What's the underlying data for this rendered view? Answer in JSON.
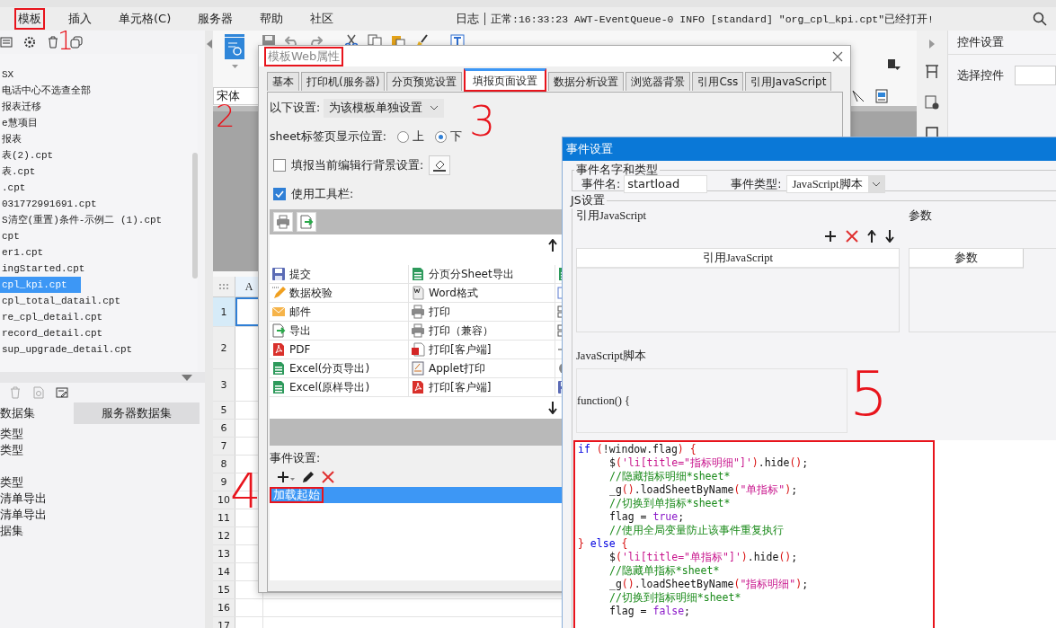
{
  "menu": [
    {
      "label": "模板",
      "annotated": true
    },
    {
      "label": "插入",
      "annotated": false
    },
    {
      "label": "单元格(C)",
      "annotated": false
    },
    {
      "label": "服务器",
      "annotated": false
    },
    {
      "label": "帮助",
      "annotated": false
    },
    {
      "label": "社区",
      "annotated": false
    }
  ],
  "status": {
    "log": "日志",
    "message": "正常:16:33:23 AWT-EventQueue-0 INFO [standard] \"org_cpl_kpi.cpt\"已经打开!"
  },
  "file_tree": [
    {
      "label": "SX",
      "selected": false
    },
    {
      "label": "电话中心不选查全部",
      "selected": false
    },
    {
      "label": "报表迁移",
      "selected": false
    },
    {
      "label": "e慧项目",
      "selected": false
    },
    {
      "label": "报表",
      "selected": false
    },
    {
      "label": "表(2).cpt",
      "selected": false
    },
    {
      "label": "表.cpt",
      "selected": false
    },
    {
      "label": ".cpt",
      "selected": false
    },
    {
      "label": "031772991691.cpt",
      "selected": false
    },
    {
      "label": "S清空(重置)条件-示例二 (1).cpt",
      "selected": false
    },
    {
      "label": "cpt",
      "selected": false
    },
    {
      "label": "er1.cpt",
      "selected": false
    },
    {
      "label": "ingStarted.cpt",
      "selected": false
    },
    {
      "label": "cpl_kpi.cpt",
      "selected": true
    },
    {
      "label": "cpl_total_datail.cpt",
      "selected": false
    },
    {
      "label": "re_cpl_detail.cpt",
      "selected": false
    },
    {
      "label": "record_detail.cpt",
      "selected": false
    },
    {
      "label": "sup_upgrade_detail.cpt",
      "selected": false
    }
  ],
  "dataset_tabs": [
    {
      "label": "数据集",
      "selected": true
    },
    {
      "label": "服务器数据集",
      "selected": false
    }
  ],
  "dataset_groups": [
    [
      "类型",
      "类型"
    ],
    [
      "类型",
      "清单导出",
      "清单导出",
      "据集"
    ]
  ],
  "designer": {
    "font": "宋体",
    "column": "A",
    "rows": [
      {
        "label": "1",
        "selected": true
      },
      {
        "label": "2",
        "selected": false
      },
      {
        "label": "3",
        "selected": false
      },
      {
        "label": "5",
        "selected": false
      },
      {
        "label": "6",
        "selected": false
      },
      {
        "label": "7",
        "selected": false
      },
      {
        "label": "8",
        "selected": false
      },
      {
        "label": "9",
        "selected": false
      },
      {
        "label": "10",
        "selected": false
      },
      {
        "label": "11",
        "selected": false
      },
      {
        "label": "12",
        "selected": false
      },
      {
        "label": "13",
        "selected": false
      },
      {
        "label": "14",
        "selected": false
      },
      {
        "label": "15",
        "selected": false
      },
      {
        "label": "16",
        "selected": false
      },
      {
        "label": "17",
        "selected": false
      }
    ]
  },
  "right_panel": {
    "title": "控件设置",
    "select_label": "选择控件"
  },
  "web_dialog": {
    "title": "模板Web属性",
    "annotated": true,
    "tabs": [
      {
        "label": "基本",
        "selected": false,
        "annotated": false
      },
      {
        "label": "打印机(服务器)",
        "selected": false,
        "annotated": false
      },
      {
        "label": "分页预览设置",
        "selected": false,
        "annotated": false
      },
      {
        "label": "填报页面设置",
        "selected": true,
        "annotated": true
      },
      {
        "label": "数据分析设置",
        "selected": false,
        "annotated": false
      },
      {
        "label": "浏览器背景",
        "selected": false,
        "annotated": false
      },
      {
        "label": "引用Css",
        "selected": false,
        "annotated": false
      },
      {
        "label": "引用JavaScript",
        "selected": false,
        "annotated": false
      }
    ],
    "scope_label": "以下设置:",
    "scope_value": "为该模板单独设置",
    "sheet_position_label": "sheet标签页显示位置:",
    "sheet_positions": [
      {
        "label": "上",
        "selected": false
      },
      {
        "label": "下",
        "selected": true
      }
    ],
    "row_background": {
      "label": "填报当前编辑行背景设置:",
      "checked": false
    },
    "use_toolbar": {
      "label": "使用工具栏:",
      "checked": true
    },
    "toolbar_buttons": [
      {
        "kind": "print"
      },
      {
        "kind": "export"
      }
    ],
    "button_rows": [
      [
        {
          "label": "提交",
          "kind": "save"
        },
        {
          "label": "分页分Sheet导出",
          "kind": "excel"
        },
        {
          "kind": "excel"
        }
      ],
      [
        {
          "label": "数据校验",
          "kind": "check"
        },
        {
          "label": "Word格式",
          "kind": "word"
        },
        {
          "kind": "window"
        }
      ],
      [
        {
          "label": "邮件",
          "kind": "mail"
        },
        {
          "label": "打印",
          "kind": "print"
        },
        {
          "kind": "split"
        }
      ],
      [
        {
          "label": "导出",
          "kind": "export"
        },
        {
          "label": "打印（兼容）",
          "kind": "print"
        },
        {
          "kind": "split"
        }
      ],
      [
        {
          "label": "PDF",
          "kind": "pdf"
        },
        {
          "label": "打印[客户端]",
          "kind": "flash"
        },
        {
          "kind": "move"
        }
      ],
      [
        {
          "label": "Excel(分页导出)",
          "kind": "excel"
        },
        {
          "label": "Applet打印",
          "kind": "applet"
        },
        {
          "kind": "gear"
        }
      ],
      [
        {
          "label": "Excel(原样导出)",
          "kind": "excel"
        },
        {
          "label": "打印[客户端]",
          "kind": "pdf"
        },
        {
          "kind": "save"
        }
      ]
    ],
    "events_label": "事件设置:",
    "events": [
      {
        "label": "加载起始",
        "selected": true,
        "annotated": true
      }
    ]
  },
  "event_dialog": {
    "title": "事件设置",
    "name_group": "事件名字和类型",
    "name_label": "事件名:",
    "name_value": "startload",
    "type_label": "事件类型:",
    "type_value": "JavaScript脚本",
    "js_group": "JS设置",
    "ref_label": "引用JavaScript",
    "ref_column": "引用JavaScript",
    "param_label": "参数",
    "param_column": "参数",
    "script_label": "JavaScript脚本",
    "function_header": "function() {",
    "code_annotated": true,
    "code": [
      {
        "indented": false,
        "tokens": [
          {
            "kind": "keyword",
            "text": "if"
          },
          {
            "kind": "punct",
            "text": " ("
          },
          {
            "kind": "plain",
            "text": "!window.flag"
          },
          {
            "kind": "punct",
            "text": ") {"
          }
        ]
      },
      {
        "indented": true,
        "tokens": [
          {
            "kind": "plain",
            "text": "$"
          },
          {
            "kind": "punct",
            "text": "("
          },
          {
            "kind": "string",
            "text": "'li[title=\"指标明细\"]'"
          },
          {
            "kind": "punct",
            "text": ")"
          },
          {
            "kind": "plain",
            "text": ".hide"
          },
          {
            "kind": "punct",
            "text": "()"
          },
          {
            "kind": "plain",
            "text": ";"
          }
        ]
      },
      {
        "indented": true,
        "tokens": [
          {
            "kind": "comment",
            "text": "//隐藏指标明细*sheet*"
          }
        ]
      },
      {
        "indented": true,
        "tokens": [
          {
            "kind": "plain",
            "text": "_g"
          },
          {
            "kind": "punct",
            "text": "()"
          },
          {
            "kind": "plain",
            "text": ".loadSheetByName"
          },
          {
            "kind": "punct",
            "text": "("
          },
          {
            "kind": "string",
            "text": "\"单指标\""
          },
          {
            "kind": "punct",
            "text": ")"
          },
          {
            "kind": "plain",
            "text": ";"
          }
        ]
      },
      {
        "indented": true,
        "tokens": [
          {
            "kind": "comment",
            "text": "//切换到单指标*sheet*"
          }
        ]
      },
      {
        "indented": true,
        "tokens": [
          {
            "kind": "plain",
            "text": "flag = "
          },
          {
            "kind": "literal",
            "text": "true"
          },
          {
            "kind": "plain",
            "text": ";"
          }
        ]
      },
      {
        "indented": true,
        "tokens": [
          {
            "kind": "comment",
            "text": "//使用全局变量防止该事件重复执行"
          }
        ]
      },
      {
        "indented": false,
        "tokens": [
          {
            "kind": "punct",
            "text": "} "
          },
          {
            "kind": "keyword",
            "text": "else"
          },
          {
            "kind": "punct",
            "text": " {"
          }
        ]
      },
      {
        "indented": true,
        "tokens": [
          {
            "kind": "plain",
            "text": "$"
          },
          {
            "kind": "punct",
            "text": "("
          },
          {
            "kind": "string",
            "text": "'li[title=\"单指标\"]'"
          },
          {
            "kind": "punct",
            "text": ")"
          },
          {
            "kind": "plain",
            "text": ".hide"
          },
          {
            "kind": "punct",
            "text": "()"
          },
          {
            "kind": "plain",
            "text": ";"
          }
        ]
      },
      {
        "indented": true,
        "tokens": [
          {
            "kind": "comment",
            "text": "//隐藏单指标*sheet*"
          }
        ]
      },
      {
        "indented": true,
        "tokens": [
          {
            "kind": "plain",
            "text": "_g"
          },
          {
            "kind": "punct",
            "text": "()"
          },
          {
            "kind": "plain",
            "text": ".loadSheetByName"
          },
          {
            "kind": "punct",
            "text": "("
          },
          {
            "kind": "string",
            "text": "\"指标明细\""
          },
          {
            "kind": "punct",
            "text": ")"
          },
          {
            "kind": "plain",
            "text": ";"
          }
        ]
      },
      {
        "indented": true,
        "tokens": [
          {
            "kind": "comment",
            "text": "//切换到指标明细*sheet*"
          }
        ]
      },
      {
        "indented": true,
        "tokens": [
          {
            "kind": "plain",
            "text": "flag = "
          },
          {
            "kind": "literal",
            "text": "false"
          },
          {
            "kind": "plain",
            "text": ";"
          }
        ]
      }
    ]
  },
  "annotations": [
    {
      "label": "1"
    },
    {
      "label": "2"
    },
    {
      "label": "3"
    },
    {
      "label": "4"
    },
    {
      "label": "5"
    }
  ]
}
